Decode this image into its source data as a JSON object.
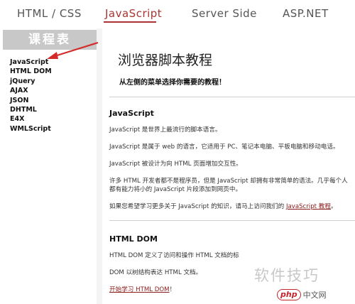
{
  "nav": {
    "tabs": [
      {
        "label": "HTML / CSS"
      },
      {
        "label": "JavaScript"
      },
      {
        "label": "Server Side"
      },
      {
        "label": "ASP.NET"
      }
    ],
    "accent": "#aa3333"
  },
  "sidebar": {
    "title": "课程表",
    "items": [
      "JavaScript",
      "HTML DOM",
      "jQuery",
      "AJAX",
      "JSON",
      "DHTML",
      "E4X",
      "WMLScript"
    ]
  },
  "main": {
    "title": "浏览器脚本教程",
    "subtitle": "从左侧的菜单选择你需要的教程！",
    "js": {
      "heading": "JavaScript",
      "p1": "JavaScript 是世界上最流行的脚本语言。",
      "p2": "JavaScript 是属于 web 的语言，它适用于 PC、笔记本电脑、平板电脑和移动电话。",
      "p3": "JavaScript 被设计为向 HTML 页面增加交互性。",
      "p4": "许多 HTML 开发者都不是程序员，但是 JavaScript 却拥有非常简单的语法。几乎每个人都有能力将小的 JavaScript 片段添加到网页中。",
      "p5_prefix": "如果您希望学习更多关于 JavaScript 的知识，请马上访问我们的",
      "p5_link": "JavaScript 教程",
      "p5_suffix": "。"
    },
    "dom": {
      "heading": "HTML DOM",
      "p1": "HTML DOM 定义了访问和操作 HTML 文档的标",
      "p2": "DOM 以树结构表达 HTML 文档。",
      "link": "开始学习 HTML DOM",
      "link_suffix": "！"
    }
  },
  "watermark": {
    "text": "软件技巧",
    "badge_php": "php",
    "badge_cn": "中文网"
  }
}
